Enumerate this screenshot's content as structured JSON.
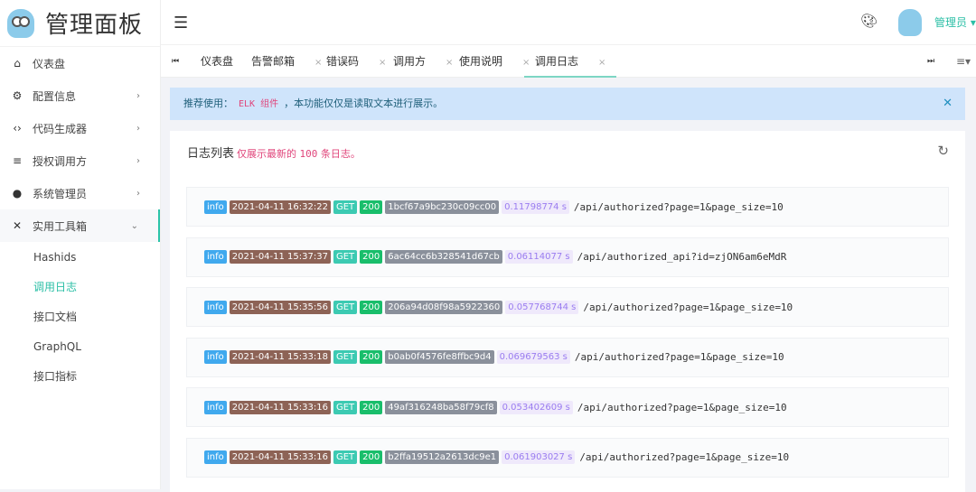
{
  "app_title": "管理面板",
  "sidebar": {
    "items": [
      {
        "label": "仪表盘",
        "icon": "home-icon",
        "glyph": "⌂"
      },
      {
        "label": "配置信息",
        "icon": "settings-icon",
        "glyph": "⚙"
      },
      {
        "label": "代码生成器",
        "icon": "code-icon",
        "glyph": "‹›"
      },
      {
        "label": "授权调用方",
        "icon": "checklist-icon",
        "glyph": "≡"
      },
      {
        "label": "系统管理员",
        "icon": "user-icon",
        "glyph": "●"
      },
      {
        "label": "实用工具箱",
        "icon": "tools-icon",
        "glyph": "✕"
      }
    ],
    "sub_items": [
      "Hashids",
      "调用日志",
      "接口文档",
      "GraphQL",
      "接口指标"
    ]
  },
  "header": {
    "user": "管理员"
  },
  "tabs": [
    "仪表盘",
    "告警邮箱",
    "错误码",
    "调用方",
    "使用说明",
    "调用日志"
  ],
  "alert": {
    "prefix": "推荐使用：",
    "highlight": "ELK 组件",
    "suffix": "，本功能仅仅是读取文本进行展示。"
  },
  "card": {
    "title": "日志列表",
    "note_prefix": "仅展示最新的",
    "note_count": "100",
    "note_suffix": "条日志。"
  },
  "colors": {
    "accent": "#2bbfa6",
    "info": "#40a9ee",
    "time": "#8d6356",
    "method": "#3ccab2",
    "status": "#19be6b",
    "id": "#8a909b"
  },
  "logs": [
    {
      "level": "info",
      "time": "2021-04-11 16:32:22",
      "method": "GET",
      "status": "200",
      "id": "1bcf67a9bc230c09cc00",
      "duration": "0.11798774 s",
      "path": "/api/authorized?page=1&page_size=10"
    },
    {
      "level": "info",
      "time": "2021-04-11 15:37:37",
      "method": "GET",
      "status": "200",
      "id": "6ac64cc6b328541d67cb",
      "duration": "0.06114077 s",
      "path": "/api/authorized_api?id=zjON6am6eMdR"
    },
    {
      "level": "info",
      "time": "2021-04-11 15:35:56",
      "method": "GET",
      "status": "200",
      "id": "206a94d08f98a5922360",
      "duration": "0.057768744 s",
      "path": "/api/authorized?page=1&page_size=10"
    },
    {
      "level": "info",
      "time": "2021-04-11 15:33:18",
      "method": "GET",
      "status": "200",
      "id": "b0ab0f4576fe8ffbc9d4",
      "duration": "0.069679563 s",
      "path": "/api/authorized?page=1&page_size=10"
    },
    {
      "level": "info",
      "time": "2021-04-11 15:33:16",
      "method": "GET",
      "status": "200",
      "id": "49af316248ba58f79cf8",
      "duration": "0.053402609 s",
      "path": "/api/authorized?page=1&page_size=10"
    },
    {
      "level": "info",
      "time": "2021-04-11 15:33:16",
      "method": "GET",
      "status": "200",
      "id": "b2ffa19512a2613dc9e1",
      "duration": "0.061903027 s",
      "path": "/api/authorized?page=1&page_size=10"
    }
  ]
}
